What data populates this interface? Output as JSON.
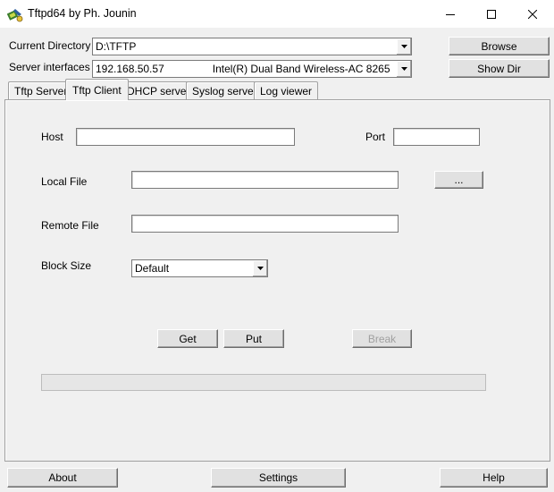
{
  "window": {
    "title": "Tftpd64 by Ph. Jounin"
  },
  "top": {
    "current_directory_label": "Current Directory",
    "current_directory_value": "D:\\TFTP",
    "server_interfaces_label": "Server interfaces",
    "server_interface_ip": "192.168.50.57",
    "server_interface_name": "Intel(R) Dual Band Wireless-AC 8265",
    "browse_label": "Browse",
    "show_dir_label": "Show Dir"
  },
  "tabs": [
    {
      "label": "Tftp Server"
    },
    {
      "label": "Tftp Client"
    },
    {
      "label": "DHCP server"
    },
    {
      "label": "Syslog server"
    },
    {
      "label": "Log viewer"
    }
  ],
  "client": {
    "host_label": "Host",
    "host_value": "",
    "port_label": "Port",
    "port_value": "",
    "local_file_label": "Local File",
    "local_file_value": "",
    "browse_dots_label": "...",
    "remote_file_label": "Remote File",
    "remote_file_value": "",
    "block_size_label": "Block Size",
    "block_size_value": "Default",
    "get_label": "Get",
    "put_label": "Put",
    "break_label": "Break",
    "progress": 0
  },
  "bottom": {
    "about_label": "About",
    "settings_label": "Settings",
    "help_label": "Help"
  },
  "icons": {
    "app": "tftpd-app-icon",
    "minimize": "minimize-icon",
    "maximize": "maximize-icon",
    "close": "close-icon",
    "dropdown": "chevron-down-icon"
  }
}
